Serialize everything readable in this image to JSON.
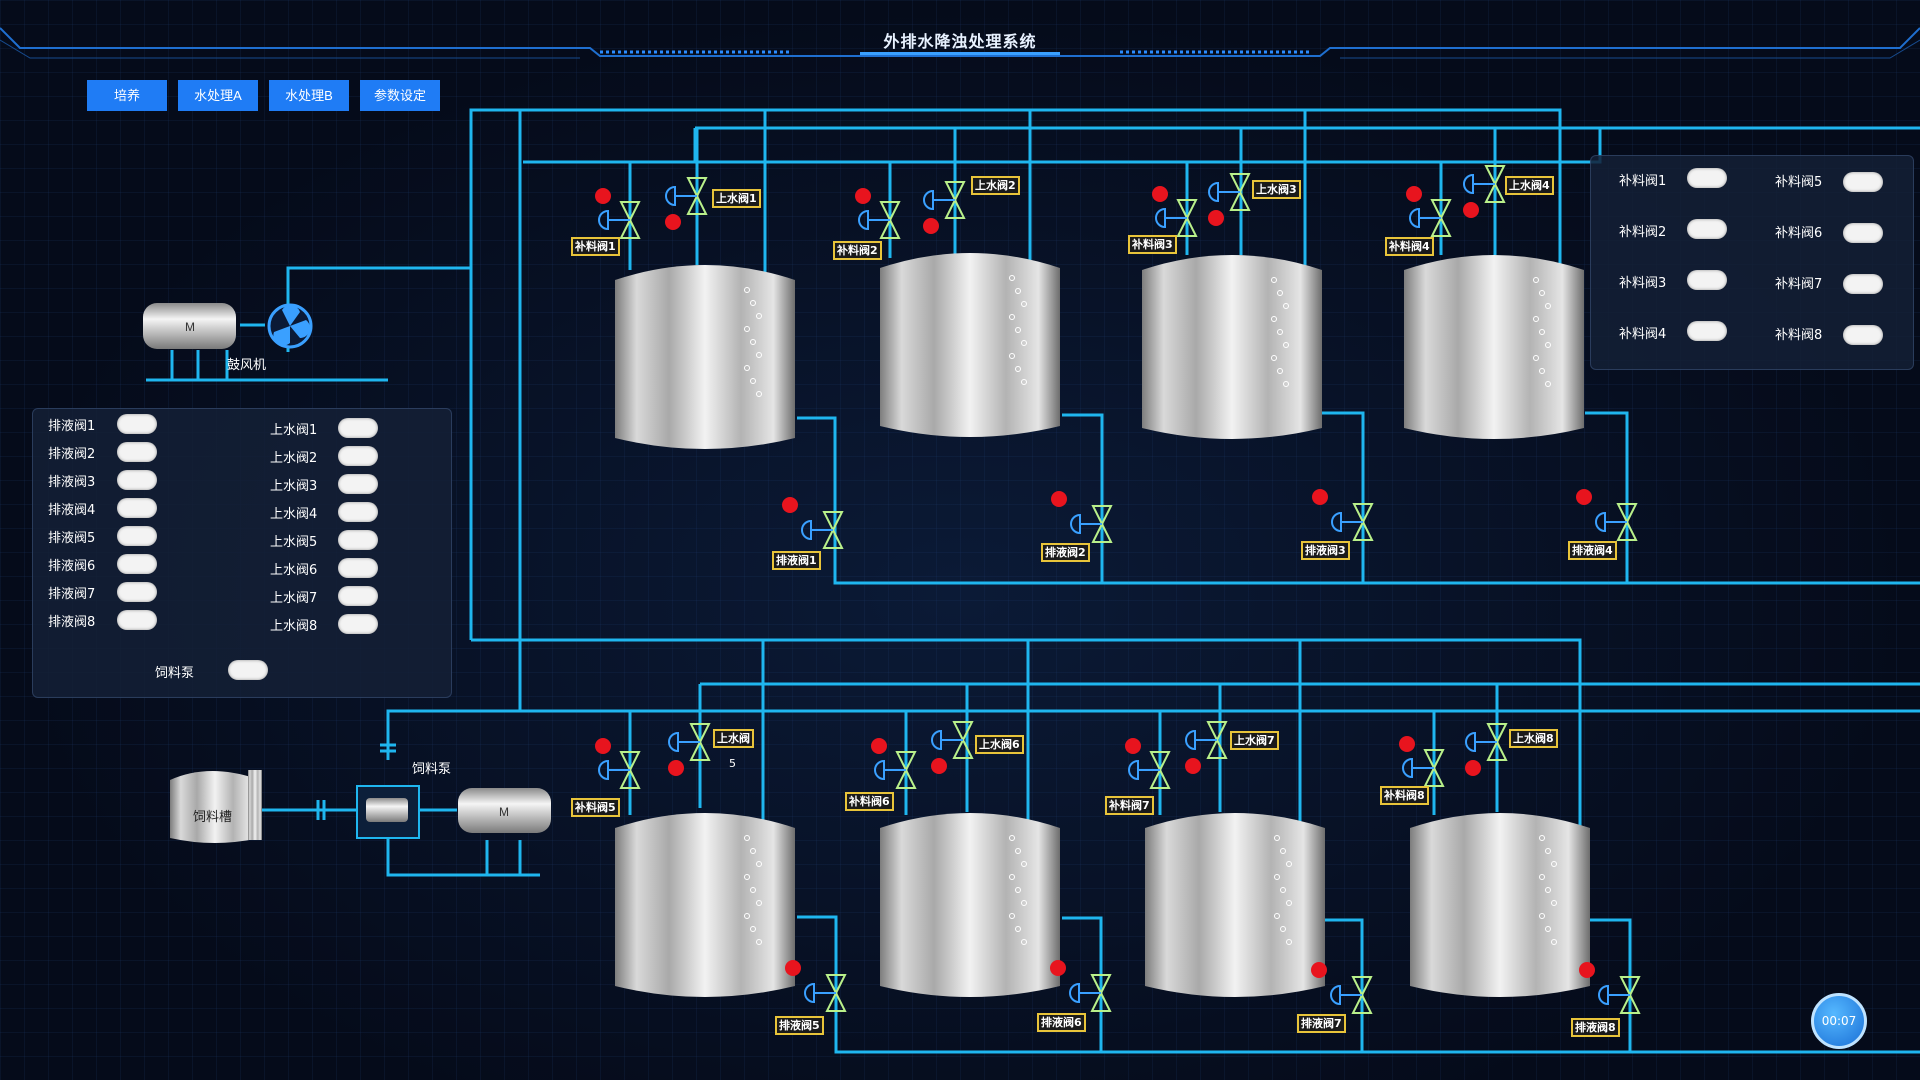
{
  "window": {
    "title": "外排水降浊处理系统"
  },
  "nav": [
    {
      "label": "培养"
    },
    {
      "label": "水处理A"
    },
    {
      "label": "水处理B"
    },
    {
      "label": "参数设定"
    }
  ],
  "blower": {
    "label": "鼓风机",
    "motor": "M"
  },
  "feed": {
    "tank": "饲料槽",
    "pump": "饲料泵",
    "motor": "M",
    "pump_small": "5"
  },
  "left_panel": {
    "drain": [
      "排液阀1",
      "排液阀2",
      "排液阀3",
      "排液阀4",
      "排液阀5",
      "排液阀6",
      "排液阀7",
      "排液阀8"
    ],
    "inlet": [
      "上水阀1",
      "上水阀2",
      "上水阀3",
      "上水阀4",
      "上水阀5",
      "上水阀6",
      "上水阀7",
      "上水阀8"
    ],
    "feed_pump": "饲料泵"
  },
  "right_panel": {
    "col1": [
      "补料阀1",
      "补料阀2",
      "补料阀3",
      "补料阀4"
    ],
    "col2": [
      "补料阀5",
      "补料阀6",
      "补料阀7",
      "补料阀8"
    ]
  },
  "tank_tags": {
    "inlet": [
      "上水阀1",
      "上水阀2",
      "上水阀3",
      "上水阀4",
      "上水阀",
      "上水阀6",
      "上水阀7",
      "上水阀8"
    ],
    "feed": [
      "补料阀1",
      "补料阀2",
      "补料阀3",
      "补料阀4",
      "补料阀5",
      "补料阀6",
      "补料阀7",
      "补料阀8"
    ],
    "drain": [
      "排液阀1",
      "排液阀2",
      "排液阀3",
      "排液阀4",
      "排液阀5",
      "排液阀6",
      "排液阀7",
      "排液阀8"
    ]
  },
  "timer": "00:07",
  "colors": {
    "pipe": "#1fb6ef",
    "accent": "#1f7cf5",
    "tag_border": "#e8c43a",
    "valve": "#b9f08a",
    "indicator": "#e8141e"
  }
}
